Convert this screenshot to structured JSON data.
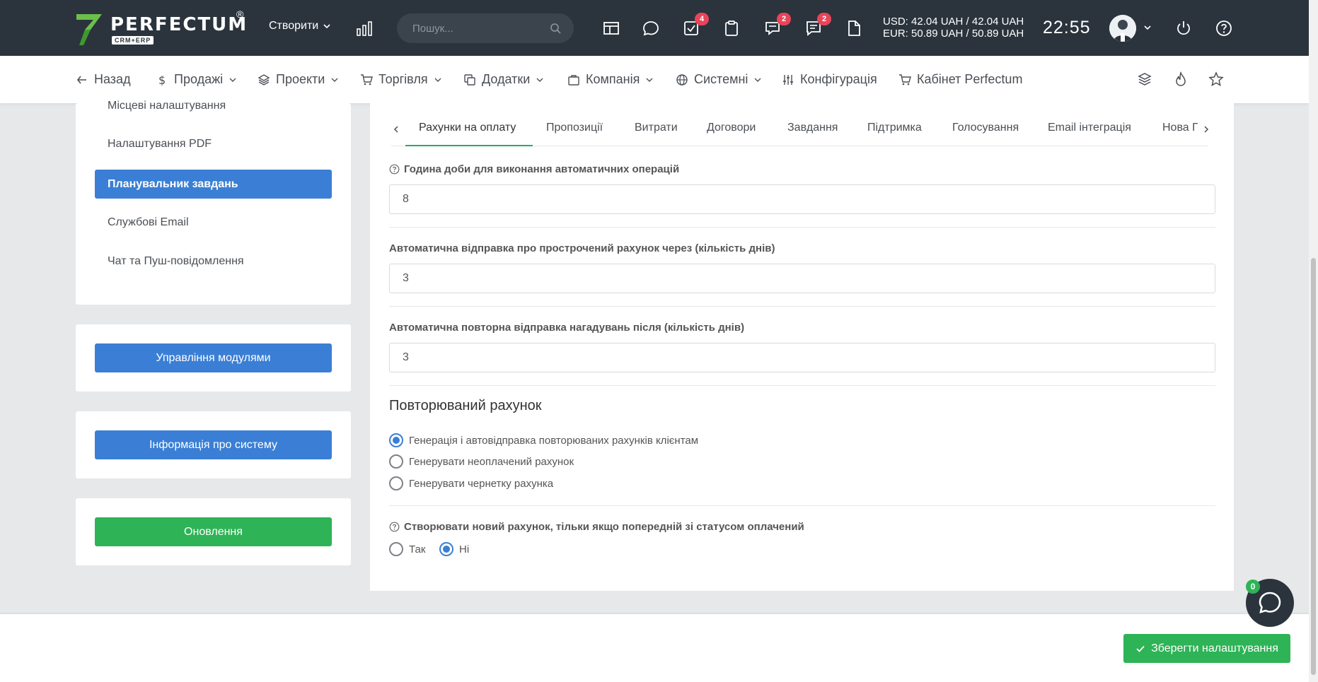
{
  "header": {
    "logo_text": "PERFECTUM",
    "logo_registered": "®",
    "logo_sub": "CRM+ERP",
    "create_label": "Створити",
    "search_placeholder": "Пошук...",
    "badges": {
      "tasks": "4",
      "discussions": "2",
      "messages": "2"
    },
    "currency_usd": "USD: 42.04 UAH / 42.04 UAH",
    "currency_eur": "EUR: 50.89 UAH / 50.89 UAH",
    "time": "22:55"
  },
  "nav": {
    "back": "Назад",
    "sales": "Продажі",
    "projects": "Проекти",
    "trade": "Торгівля",
    "addons": "Додатки",
    "company": "Компанія",
    "system": "Системні",
    "config": "Конфігурація",
    "cabinet": "Кабінет Perfectum"
  },
  "sidebar": {
    "items": [
      {
        "label": "Місцеві налаштування"
      },
      {
        "label": "Налаштування PDF"
      },
      {
        "label": "Планувальник завдань"
      },
      {
        "label": "Службові Email"
      },
      {
        "label": "Чат та Пуш-повідомлення"
      }
    ],
    "modules_button": "Управління модулями",
    "system_info_button": "Інформація про систему",
    "update_button": "Оновлення"
  },
  "tabs": [
    {
      "label": "Рахунки на оплату"
    },
    {
      "label": "Пропозиції"
    },
    {
      "label": "Витрати"
    },
    {
      "label": "Договори"
    },
    {
      "label": "Завдання"
    },
    {
      "label": "Підтримка"
    },
    {
      "label": "Голосування"
    },
    {
      "label": "Email інтеграція"
    },
    {
      "label": "Нова П"
    }
  ],
  "form": {
    "hour_label": "Година доби для виконання автоматичних операцій",
    "hour_value": "8",
    "overdue_label": "Автоматична відправка про прострочений рахунок через (кількість днів)",
    "overdue_value": "3",
    "resend_label": "Автоматична повторна відправка нагадувань після (кількість днів)",
    "resend_value": "3",
    "recurring_title": "Повторюваний рахунок",
    "recurring_options": [
      {
        "label": "Генерація і автовідправка повторюваних рахунків клієнтам",
        "checked": true
      },
      {
        "label": "Генерувати неоплачений рахунок",
        "checked": false
      },
      {
        "label": "Генерувати чернетку рахунка",
        "checked": false
      }
    ],
    "only_paid_label": "Створювати новий рахунок, тільки якщо попередній зі статусом оплачений",
    "yes_label": "Так",
    "no_label": "Ні",
    "only_paid_value": "Ні"
  },
  "footer": {
    "save_button": "Зберегти налаштування",
    "chat_count": "0"
  },
  "colors": {
    "header_bg": "#2b343d",
    "primary_blue": "#3a7fd5",
    "success_green": "#2eb356",
    "tab_accent": "#2aa96a",
    "badge_red": "#e9445a"
  }
}
